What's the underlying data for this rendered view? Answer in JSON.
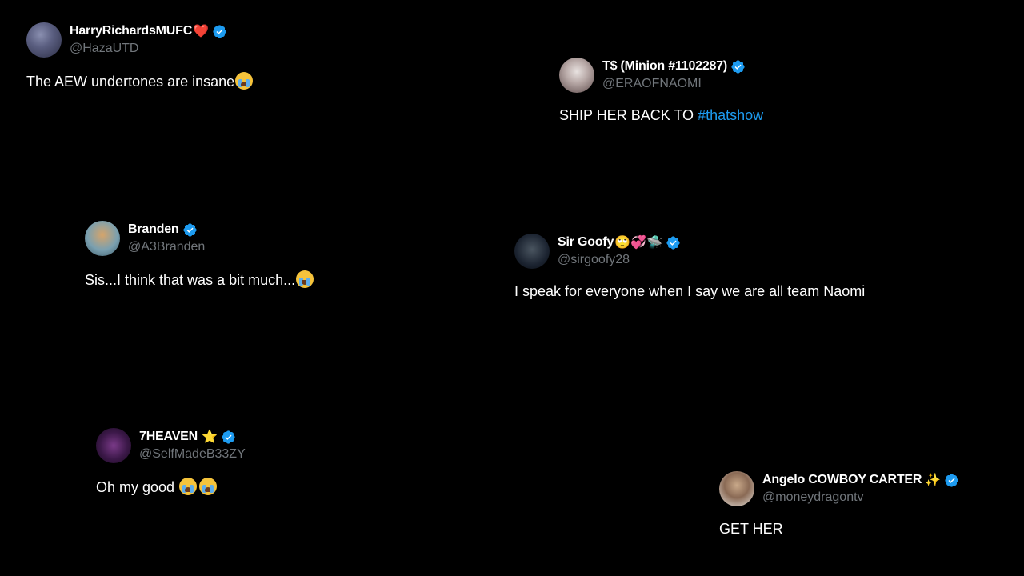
{
  "colors": {
    "background": "#000000",
    "verified": "#1d9bf0",
    "hashtag": "#1d9bf0",
    "handle": "#71767b"
  },
  "tweets": [
    {
      "display_name": "HarryRichardsMUFC",
      "name_emoji": "❤️",
      "handle": "@HazaUTD",
      "text": "The AEW undertones are insane",
      "text_emoji": "crying-face-icon"
    },
    {
      "display_name": "T$ (Minion #1102287)",
      "handle": "@ERAOFNAOMI",
      "text": "SHIP HER BACK TO ",
      "hashtag": "#thatshow"
    },
    {
      "display_name": "Branden",
      "handle": "@A3Branden",
      "text": "Sis...I think that was a bit much...",
      "text_emoji": "tears-of-joy-icon"
    },
    {
      "display_name": "Sir Goofy",
      "name_emoji": "🙄💞🛸",
      "handle": "@sirgoofy28",
      "text": "I speak for everyone when I say we are all team Naomi"
    },
    {
      "display_name": "7HEAVEN",
      "name_emoji": "⭐",
      "handle": "@SelfMadeB33ZY",
      "text": "Oh my good ",
      "text_emoji": "crying-face-icon"
    },
    {
      "display_name": "Angelo COWBOY CARTER",
      "name_emoji": "✨",
      "handle": "@moneydragontv",
      "text": "GET HER"
    }
  ]
}
